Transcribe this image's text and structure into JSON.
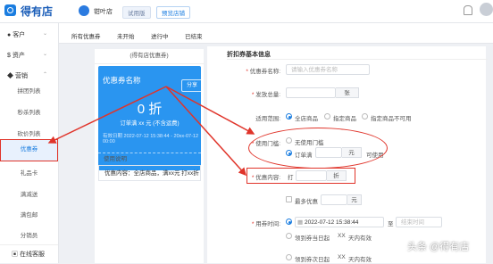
{
  "header": {
    "app_name": "得有店",
    "shop_name": "钳叶店",
    "trial_badge": "试用版",
    "preview_button": "预览店铺"
  },
  "sidebar": {
    "groups": [
      {
        "label": "客户",
        "icon": "user-icon"
      },
      {
        "label": "资产",
        "icon": "dollar-icon"
      },
      {
        "label": "营销",
        "icon": "tag-icon"
      }
    ],
    "items": [
      "拼团列表",
      "秒杀列表",
      "砍价列表",
      "优惠券",
      "礼品卡",
      "满减送",
      "满包邮",
      "分销员"
    ],
    "active_item": "优惠券",
    "service": "在线客服"
  },
  "tabs": [
    "所有优惠券",
    "未开始",
    "进行中",
    "已结束"
  ],
  "preview": {
    "header": "(得有店优惠券)",
    "coupon_name": "优惠券名称",
    "share": "分享",
    "discount": "0 折",
    "rule": "订单满 xx 元 (不含运费)",
    "valid_prefix": "有效日期",
    "valid_range": "2022-07-12 15:38:44 - 20xx-07-12 00:00",
    "usage_title": "使用说明",
    "usage_body": "优惠内容：全店商品，满xx元 打xx折"
  },
  "form": {
    "section_title": "折扣券基本信息",
    "name_label": "优惠券名称:",
    "name_placeholder": "请输入优惠券名称",
    "total_label": "发放总量:",
    "total_unit": "张",
    "scope_label": "适用范围:",
    "scope_options": [
      "全店商品",
      "指定商品",
      "指定商品不可用"
    ],
    "threshold_label": "使用门槛:",
    "threshold_none": "无使用门槛",
    "threshold_order": "订单满",
    "threshold_unit": "元",
    "threshold_suffix": "可使用",
    "content_label": "优惠内容:",
    "content_prefix": "打",
    "content_suffix": "折",
    "max_discount_label": "最多优惠",
    "max_discount_unit": "元",
    "time_label": "用券时间:",
    "time_start": "2022-07-12 15:38:44",
    "time_sep": "至",
    "time_end_placeholder": "结束时间",
    "opt_day1": "领到券当日起",
    "opt_day2": "领到券次日起",
    "opt_days_val": "XX",
    "opt_days_unit": "天内有效"
  },
  "watermark": "头条 @得有店",
  "colors": {
    "accent": "#1a7de0",
    "coupon": "#2a95f0",
    "annotation": "#e0342a"
  }
}
